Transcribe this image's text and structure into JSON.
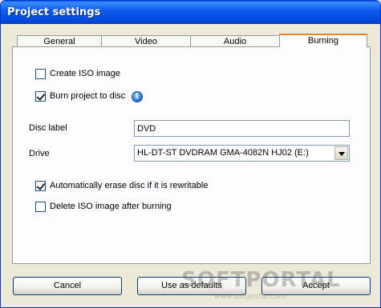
{
  "window": {
    "title": "Project settings"
  },
  "tabs": [
    {
      "label": "General"
    },
    {
      "label": "Video"
    },
    {
      "label": "Audio"
    },
    {
      "label": "Burning",
      "active": true
    }
  ],
  "burning": {
    "create_iso": {
      "label": "Create ISO image",
      "checked": false
    },
    "burn_project": {
      "label": "Burn project to disc",
      "checked": true
    },
    "info_icon": "info-icon",
    "disc_label": {
      "label": "Disc label",
      "value": "DVD"
    },
    "drive": {
      "label": "Drive",
      "selected": "HL-DT-ST DVDRAM GMA-4082N HJ02 (E:)"
    },
    "auto_erase": {
      "label": "Automatically erase disc if it is rewritable",
      "checked": true
    },
    "delete_iso": {
      "label": "Delete ISO image after burning",
      "checked": false
    }
  },
  "buttons": {
    "cancel": "Cancel",
    "use_defaults": "Use as defaults",
    "accept": "Accept"
  },
  "watermark": {
    "brand": "SOFTPORTAL",
    "url": "www.softportal.com"
  },
  "colors": {
    "title_bar": "#0054e3",
    "active_tab_accent": "#e68b2c",
    "window_bg": "#ece9d8"
  }
}
